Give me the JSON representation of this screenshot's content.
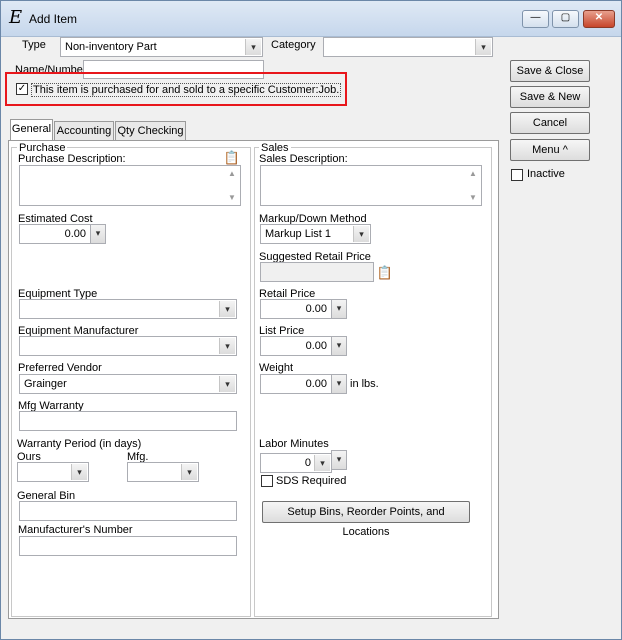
{
  "window": {
    "title": "Add Item",
    "app_icon_glyph": "E",
    "controls": {
      "minimize": "—",
      "maximize": "▢",
      "close": "✕"
    }
  },
  "header": {
    "type_label": "Type",
    "type_value": "Non-inventory Part",
    "category_label": "Category",
    "category_value": "",
    "name_label": "Name/Number",
    "name_value": "",
    "specific_customer_label": "This item is purchased for and sold to a specific Customer:Job.",
    "specific_customer_checked": true
  },
  "buttons": {
    "save_close": "Save & Close",
    "save_new": "Save & New",
    "cancel": "Cancel",
    "menu": "Menu ^",
    "inactive_label": "Inactive",
    "setup_bins": "Setup Bins, Reorder Points, and Locations"
  },
  "tabs": [
    {
      "label": "General",
      "active": true
    },
    {
      "label": "Accounting",
      "active": false
    },
    {
      "label": "Qty Checking",
      "active": false
    }
  ],
  "purchase": {
    "group_title": "Purchase",
    "description_label": "Purchase Description:",
    "description_value": "",
    "estimated_cost_label": "Estimated Cost",
    "estimated_cost_value": "0.00",
    "equipment_type_label": "Equipment Type",
    "equipment_type_value": "",
    "equipment_manufacturer_label": "Equipment Manufacturer",
    "equipment_manufacturer_value": "",
    "preferred_vendor_label": "Preferred Vendor",
    "preferred_vendor_value": "Grainger",
    "mfg_warranty_label": "Mfg Warranty",
    "mfg_warranty_value": "",
    "warranty_period_label": "Warranty Period (in days)",
    "ours_label": "Ours",
    "ours_value": "",
    "mfg_label": "Mfg.",
    "mfg_value": "",
    "general_bin_label": "General Bin",
    "general_bin_value": "",
    "manufacturer_number_label": "Manufacturer's Number",
    "manufacturer_number_value": ""
  },
  "sales": {
    "group_title": "Sales",
    "description_label": "Sales Description:",
    "description_value": "",
    "markup_method_label": "Markup/Down Method",
    "markup_method_value": "Markup List 1",
    "suggested_retail_label": "Suggested Retail Price",
    "suggested_retail_value": "",
    "retail_price_label": "Retail Price",
    "retail_price_value": "0.00",
    "list_price_label": "List Price",
    "list_price_value": "0.00",
    "weight_label": "Weight",
    "weight_value": "0.00",
    "weight_unit": "in lbs.",
    "labor_minutes_label": "Labor Minutes",
    "labor_minutes_value": "0",
    "sds_required_label": "SDS Required",
    "sds_required_checked": false
  },
  "icons": {
    "dropdown_arrow": "▾",
    "scroll_up": "▲",
    "scroll_down": "▼",
    "spellcheck": "📋",
    "check": "✓"
  }
}
